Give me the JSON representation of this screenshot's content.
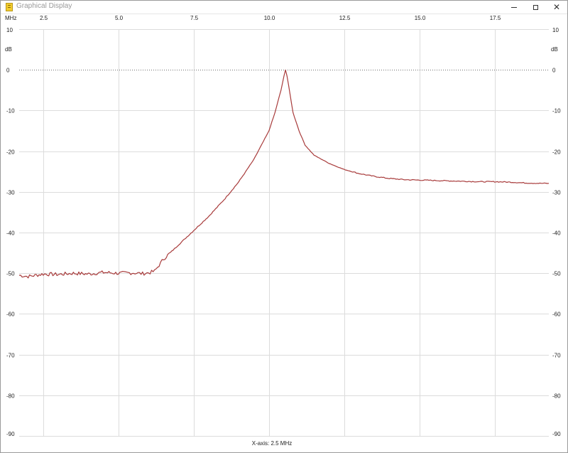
{
  "window": {
    "title": "Graphical Display",
    "controls": {
      "minimize": "minimize-icon",
      "maximize": "maximize-icon",
      "close": "close-icon"
    }
  },
  "colors": {
    "trace": "#a83b3b",
    "grid": "#dcdcdc",
    "zero_line": "#707070",
    "background": "#ffffff"
  },
  "chart_data": {
    "type": "line",
    "title": "",
    "x_unit": "MHz",
    "y_unit": "dB",
    "xlabel": "X-axis: 2.5 MHz",
    "ylabel": "dB",
    "xlim": [
      1.7,
      19.3
    ],
    "ylim": [
      -90,
      10
    ],
    "x_ticks": [
      2.5,
      5.0,
      7.5,
      10.0,
      12.5,
      15.0,
      17.5
    ],
    "x_tick_labels": [
      "2.5",
      "5.0",
      "7.5",
      "10.0",
      "12.5",
      "15.0",
      "17.5"
    ],
    "y_ticks": [
      10,
      0,
      -10,
      -20,
      -30,
      -40,
      -50,
      -60,
      -70,
      -80,
      -90
    ],
    "y_tick_labels": [
      "10",
      "0",
      "-10",
      "-20",
      "-30",
      "-40",
      "-50",
      "-60",
      "-70",
      "-80",
      "-90"
    ],
    "grid": true,
    "reference_line": {
      "y": 0,
      "style": "dotted"
    },
    "series": [
      {
        "x": [
          1.7,
          2.0,
          2.5,
          3.0,
          3.5,
          4.0,
          4.5,
          5.0,
          5.5,
          5.8,
          6.0,
          6.2,
          6.5,
          7.0,
          7.5,
          8.0,
          8.5,
          9.0,
          9.5,
          10.0,
          10.2,
          10.4,
          10.5,
          10.55,
          10.6,
          10.7,
          10.8,
          11.0,
          11.2,
          11.5,
          12.0,
          12.5,
          13.0,
          13.5,
          14.0,
          14.5,
          15.0,
          15.5,
          16.0,
          16.5,
          17.0,
          17.5,
          18.0,
          18.5,
          19.0,
          19.3
        ],
        "y": [
          -50.5,
          -50.8,
          -50.2,
          -50.3,
          -50.0,
          -50.2,
          -49.8,
          -50.0,
          -49.9,
          -50.1,
          -49.9,
          -49.5,
          -46.5,
          -43.0,
          -39.5,
          -36.0,
          -32.0,
          -27.5,
          -22.0,
          -15.0,
          -10.5,
          -5.0,
          -1.5,
          0.0,
          -1.5,
          -6.0,
          -10.5,
          -15.0,
          -18.5,
          -21.0,
          -23.0,
          -24.5,
          -25.5,
          -26.2,
          -26.7,
          -27.0,
          -27.1,
          -27.2,
          -27.3,
          -27.4,
          -27.5,
          -27.5,
          -27.6,
          -27.8,
          -27.9,
          -27.9
        ]
      }
    ]
  }
}
